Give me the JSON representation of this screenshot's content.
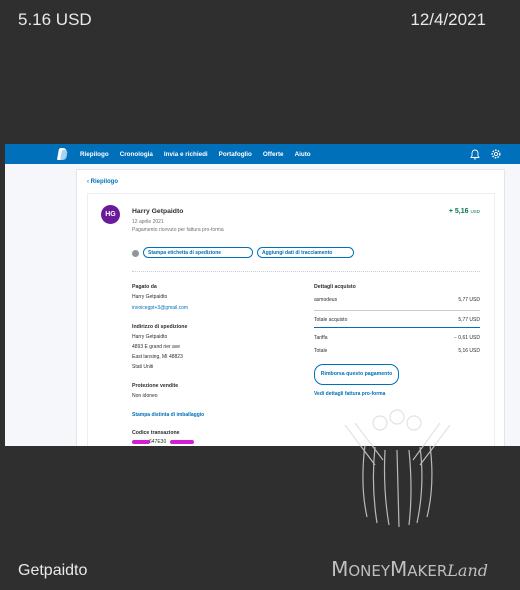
{
  "header": {
    "amount": "5.16 USD",
    "date": "12/4/2021"
  },
  "footer": {
    "seller": "Getpaidto",
    "brand_1": "M",
    "brand_2": "ONEY",
    "brand_3": "M",
    "brand_4": "AKER",
    "brand_5": "Land"
  },
  "nav": {
    "items": [
      "Riepilogo",
      "Cronologia",
      "Invia e richiedi",
      "Portafoglio",
      "Offerte",
      "Aiuto"
    ],
    "bg_color": "#0070ba",
    "icons": [
      "paypal-logo-icon",
      "bell-icon",
      "gear-icon"
    ]
  },
  "back_link": "Riepilogo",
  "transaction": {
    "avatar_initials": "HG",
    "avatar_color": "#6a1b9a",
    "name": "Harry Getpaidto",
    "date": "12 aprile 2021",
    "type": "Pagamento ricevuto per fattura pro-forma",
    "amount": "+ 5,16",
    "currency": "USD",
    "amount_color": "#017a4d"
  },
  "actions": {
    "print_label": "Stampa etichetta di spedizione",
    "tracking": "Aggiungi dati di tracciamento"
  },
  "paid_by": {
    "label": "Pagato da",
    "name": "Harry Getpaidto",
    "email": "invoicegpt+3@gmail.com"
  },
  "shipping": {
    "label": "Indirizzo di spedizione",
    "lines": [
      "Harry Getpaidto",
      "4893 E grand rier ave",
      "East lansing, MI 48823",
      "Stati Uniti"
    ]
  },
  "protection": {
    "label": "Protezione vendite",
    "value": "Non idoneo"
  },
  "packing_slip": "Stampa distinta di imballaggio",
  "transaction_code": {
    "label": "Codice transazione",
    "visible_part": "647E30"
  },
  "purchase": {
    "label": "Dettagli acquisto",
    "item_name": "asmodeus",
    "item_price": "5,77 USD",
    "total_label": "Totale acquisto",
    "total_value": "5,77 USD",
    "fee_label": "Tariffa",
    "fee_value": "− 0,61 USD",
    "net_label": "Totale",
    "net_value": "5,16 USD",
    "refund_button": "Rimborsa questo pagamento",
    "invoice_link": "Vedi dettagli fattura pro-forma"
  }
}
